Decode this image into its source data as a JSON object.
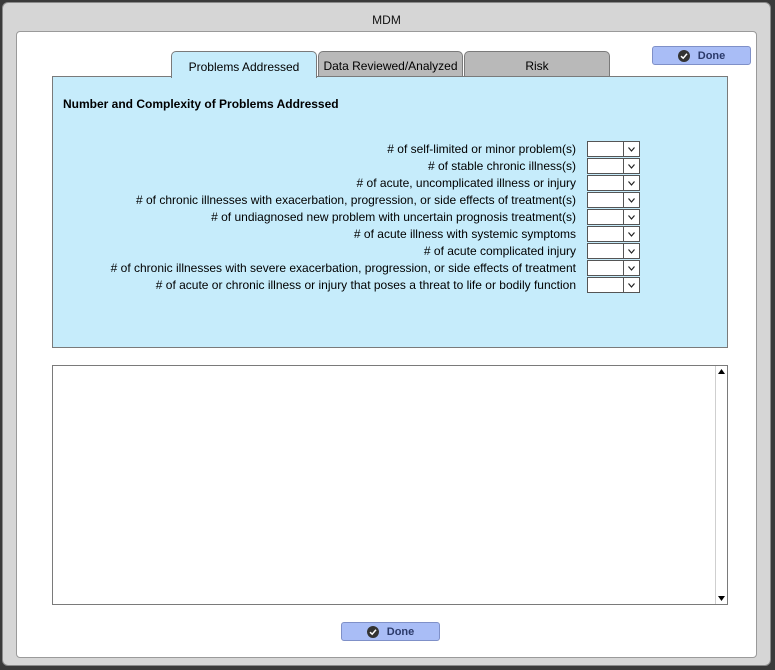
{
  "window": {
    "title": "MDM"
  },
  "tabs": [
    {
      "label": "Problems Addressed",
      "active": true
    },
    {
      "label": "Data Reviewed/Analyzed",
      "active": false
    },
    {
      "label": "Risk",
      "active": false
    }
  ],
  "buttons": {
    "done_top": "Done",
    "done_bottom": "Done"
  },
  "panel": {
    "heading": "Number and Complexity of Problems Addressed",
    "rows": [
      {
        "label": "# of self-limited or minor problem(s)",
        "value": ""
      },
      {
        "label": "# of stable chronic illness(s)",
        "value": ""
      },
      {
        "label": "# of acute, uncomplicated illness or injury",
        "value": ""
      },
      {
        "label": "# of chronic illnesses with exacerbation, progression, or side effects of treatment(s)",
        "value": ""
      },
      {
        "label": "# of undiagnosed new problem with uncertain prognosis treatment(s)",
        "value": ""
      },
      {
        "label": "# of acute illness with systemic symptoms",
        "value": ""
      },
      {
        "label": "# of acute complicated injury",
        "value": ""
      },
      {
        "label": "# of chronic illnesses with severe exacerbation, progression, or side effects of treatment",
        "value": ""
      },
      {
        "label": "# of acute or chronic illness or injury that poses a threat to life or bodily function",
        "value": ""
      }
    ]
  },
  "notes": {
    "value": ""
  },
  "icons": {
    "done": "check-circle-icon",
    "dropdown": "chevron-down-icon"
  },
  "colors": {
    "panel_bg": "#c6ecfb",
    "button_bg": "#a9bdf6",
    "tab_inactive": "#b9b9b9"
  }
}
